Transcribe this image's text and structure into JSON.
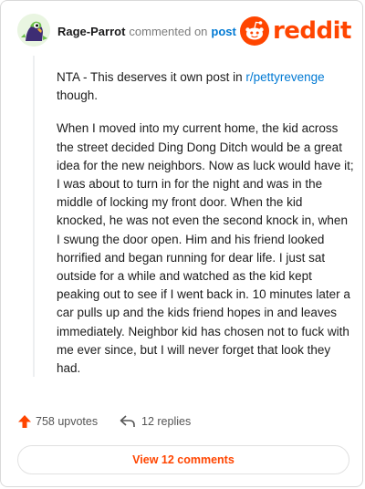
{
  "header": {
    "username": "Rage-Parrot",
    "action": "commented on",
    "post_link": "post",
    "brand": "reddit"
  },
  "comment": {
    "para1_prefix": "NTA - This deserves it own post in ",
    "para1_link": "r/pettyrevenge",
    "para1_suffix": " though.",
    "para2": "When I moved into my current home, the kid across the street decided Ding Dong Ditch would be a great idea for the new neighbors. Now as luck would have it; I was about to turn in for the night and was in the middle of locking my front door. When the kid knocked, he was not even the second knock in, when I swung the door open. Him and his friend looked horrified and began running for dear life. I just sat outside for a while and watched as the kid kept peaking out to see if I went back in. 10 minutes later a car pulls up and the kids friend hopes in and leaves immediately. Neighbor kid has chosen not to fuck with me ever since, but I will never forget that look they had."
  },
  "footer": {
    "upvotes": "758 upvotes",
    "replies": "12 replies",
    "view_comments": "View 12 comments"
  },
  "colors": {
    "accent": "#ff4500",
    "link": "#0079d3"
  },
  "icons": {
    "avatar": "parrot-avatar",
    "logo": "reddit-snoo-icon",
    "upvote": "upvote-arrow-icon",
    "reply": "reply-arrow-icon"
  }
}
